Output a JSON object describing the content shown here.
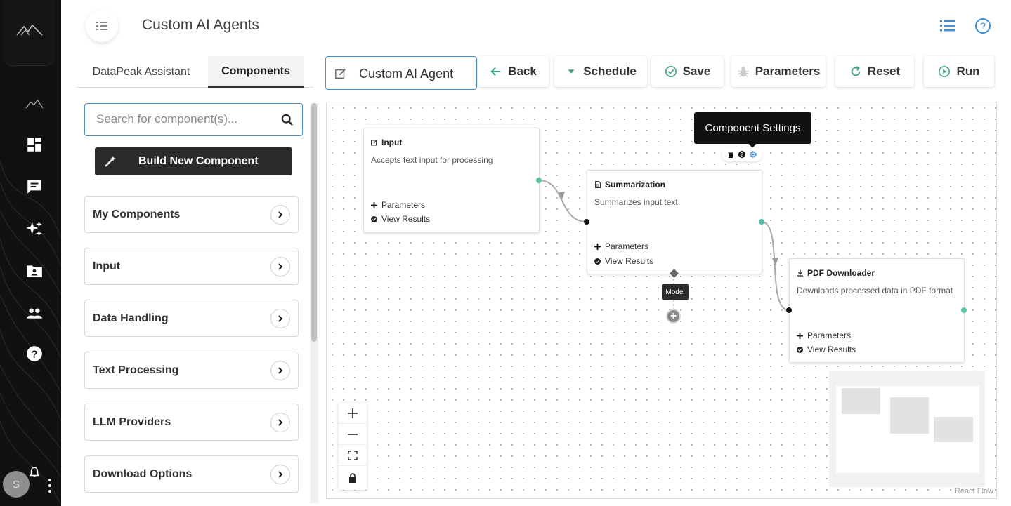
{
  "header": {
    "title": "Custom AI Agents"
  },
  "sidebar": {
    "avatar_initial": "S",
    "items": [
      {
        "icon": "mountain-icon"
      },
      {
        "icon": "dashboard-icon"
      },
      {
        "icon": "chat-icon"
      },
      {
        "icon": "sparkles-icon"
      },
      {
        "icon": "contact-folder-icon"
      },
      {
        "icon": "people-icon"
      },
      {
        "icon": "help-icon"
      }
    ]
  },
  "tabs": [
    {
      "label": "DataPeak Assistant",
      "active": false
    },
    {
      "label": "Components",
      "active": true
    }
  ],
  "panel": {
    "search_placeholder": "Search for component(s)...",
    "build_label": "Build New Component",
    "categories": [
      "My Components",
      "Input",
      "Data Handling",
      "Text Processing",
      "LLM Providers",
      "Download Options"
    ]
  },
  "toolbar": {
    "agent_name": "Custom AI Agent",
    "back": "Back",
    "schedule": "Schedule",
    "save": "Save",
    "parameters": "Parameters",
    "reset": "Reset",
    "run": "Run"
  },
  "canvas": {
    "tooltip": "Component Settings",
    "model_label": "Model",
    "attribution": "React Flow",
    "nodes": [
      {
        "title": "Input",
        "description": "Accepts text input for processing",
        "params": "Parameters",
        "results": "View Results"
      },
      {
        "title": "Summarization",
        "description": "Summarizes input text",
        "params": "Parameters",
        "results": "View Results"
      },
      {
        "title": "PDF Downloader",
        "description": "Downloads processed data in PDF format",
        "params": "Parameters",
        "results": "View Results"
      }
    ]
  },
  "colors": {
    "accent_blue": "#4a8ecb",
    "handle_green": "#5bc0a6",
    "rail_bg": "#111111",
    "dark_button": "#2b2b2b"
  }
}
